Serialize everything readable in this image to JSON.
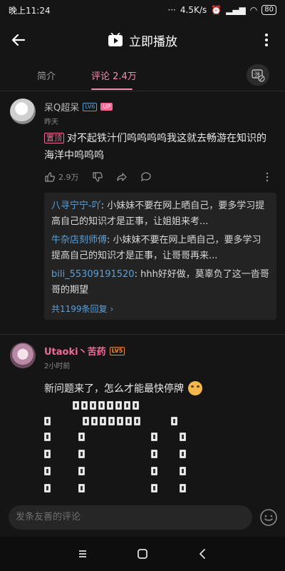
{
  "status": {
    "time": "晚上11:24",
    "speed": "4.5K/s",
    "battery": "80"
  },
  "header": {
    "title": "立即播放"
  },
  "tabs": [
    {
      "label": "简介"
    },
    {
      "label": "评论 2.4万"
    }
  ],
  "comments": [
    {
      "user": "呆Q超呆",
      "level": "LV6",
      "badge": "UP",
      "time": "昨天",
      "pin_label": "置顶",
      "text": "对不起铁汁们呜呜呜呜我这就去畅游在知识的海洋中呜呜呜",
      "likes": "2.9万",
      "replies": [
        {
          "name": "八寻宁宁-吖",
          "text": ": 小妹妹不要在网上晒自己，要多学习提高自己的知识才是正事，让姐姐来考..."
        },
        {
          "name": "牛杂店刻师傅",
          "text": ": 小妹妹不要在网上晒自己，要多学习提高自己的知识才是正事，让哥哥再来..."
        },
        {
          "name": "bili_55309191520",
          "text": ": hhh好好做，莫辜负了这一沓哥哥的期望"
        }
      ],
      "reply_more": "共1199条回复"
    },
    {
      "user": "Utaoki丶苦药",
      "level": "LV5",
      "time": "2小时前",
      "text": "新问题来了，怎么才能最快停牌"
    }
  ],
  "input": {
    "placeholder": "发条友善的评论"
  },
  "icons": {
    "back": "back-arrow-icon",
    "more": "more-vertical-icon",
    "play": "play-logo-icon",
    "danmaku": "danmaku-off-icon",
    "like": "thumb-up-icon",
    "dislike": "thumb-down-icon",
    "share": "share-icon",
    "comment": "comment-icon",
    "emoji": "emoji-icon"
  },
  "colors": {
    "accent": "#f06b96",
    "link": "#5aa0d8",
    "background": "#151515"
  }
}
